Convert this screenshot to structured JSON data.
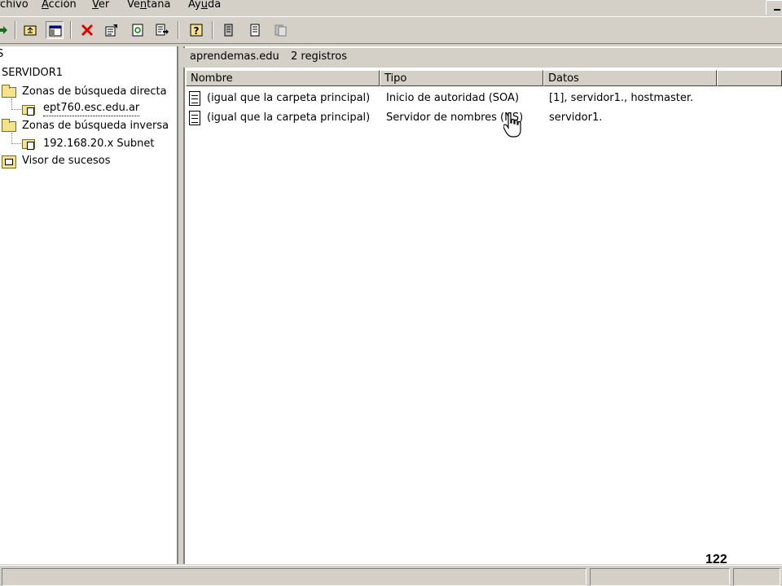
{
  "menu": [
    {
      "pre": "",
      "u": "",
      "post": "rchivo"
    },
    {
      "pre": "",
      "u": "A",
      "post": "cción"
    },
    {
      "pre": "",
      "u": "V",
      "post": "er"
    },
    {
      "pre": "Ve",
      "u": "n",
      "post": "tana"
    },
    {
      "pre": "Ay",
      "u": "u",
      "post": "da"
    }
  ],
  "tree": {
    "root_fragment": "S",
    "server": "SERVIDOR1",
    "items": [
      {
        "label": "Zonas de búsqueda directa"
      },
      {
        "label": "ept760.esc.edu.ar"
      },
      {
        "label": "Zonas de búsqueda inversa"
      },
      {
        "label": "192.168.20.x Subnet"
      },
      {
        "label": "Visor de sucesos"
      }
    ]
  },
  "right_header": {
    "zone": "aprendemas.edu",
    "count": "2 registros"
  },
  "columns": [
    "Nombre",
    "Tipo",
    "Datos"
  ],
  "rows": [
    {
      "name": "(igual que la carpeta principal)",
      "type": "Inicio de autoridad (SOA)",
      "data": "[1], servidor1., hostmaster."
    },
    {
      "name": "(igual que la carpeta principal)",
      "type": "Servidor de nombres (NS)",
      "data": "servidor1."
    }
  ],
  "slide_number": "122",
  "colors": {
    "chrome": "#d4d0c8",
    "folder": "#f4e38a",
    "delete_icon": "#e00000"
  }
}
